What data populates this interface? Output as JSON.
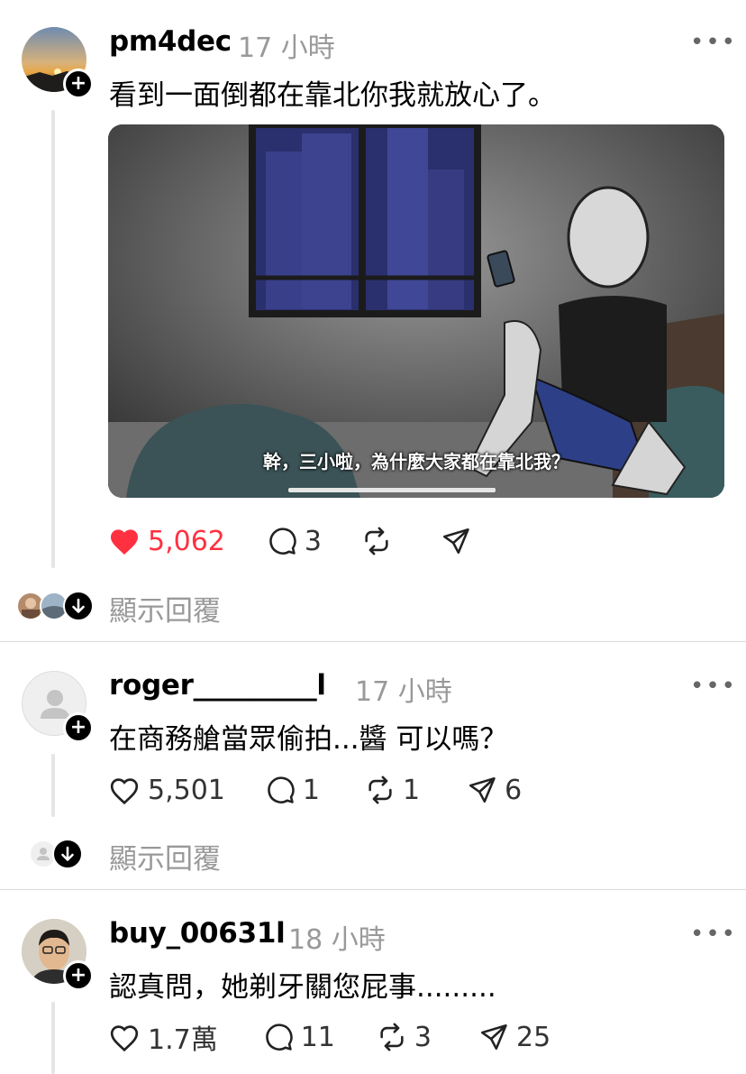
{
  "posts": [
    {
      "username": "pm4dec",
      "time": "17 小時",
      "text": "看到一面倒都在靠北你我就放心了。",
      "media_caption": "幹，三小啦，為什麼大家都在靠北我？",
      "likes": "5,062",
      "liked": true,
      "replies": "3",
      "reposts": "",
      "shares": "",
      "show_replies": "顯示回覆"
    },
    {
      "username": "roger_________l",
      "time": "17 小時",
      "text": "在商務艙當眾偷拍...醬 可以嗎？",
      "likes": "5,501",
      "liked": false,
      "replies": "1",
      "reposts": "1",
      "shares": "6",
      "show_replies": "顯示回覆"
    },
    {
      "username": "buy_00631l",
      "time": "18 小時",
      "text": "認真問，她剃牙關您屁事.........",
      "likes": "1.7萬",
      "liked": false,
      "replies": "11",
      "reposts": "3",
      "shares": "25"
    }
  ],
  "colors": {
    "like_red": "#ff3040",
    "muted_gray": "#999999",
    "divider": "#dbdbdb"
  },
  "icons": [
    "heart-icon",
    "comment-icon",
    "repost-icon",
    "share-icon",
    "more-icon",
    "follow-plus-icon",
    "arrow-down-icon"
  ]
}
